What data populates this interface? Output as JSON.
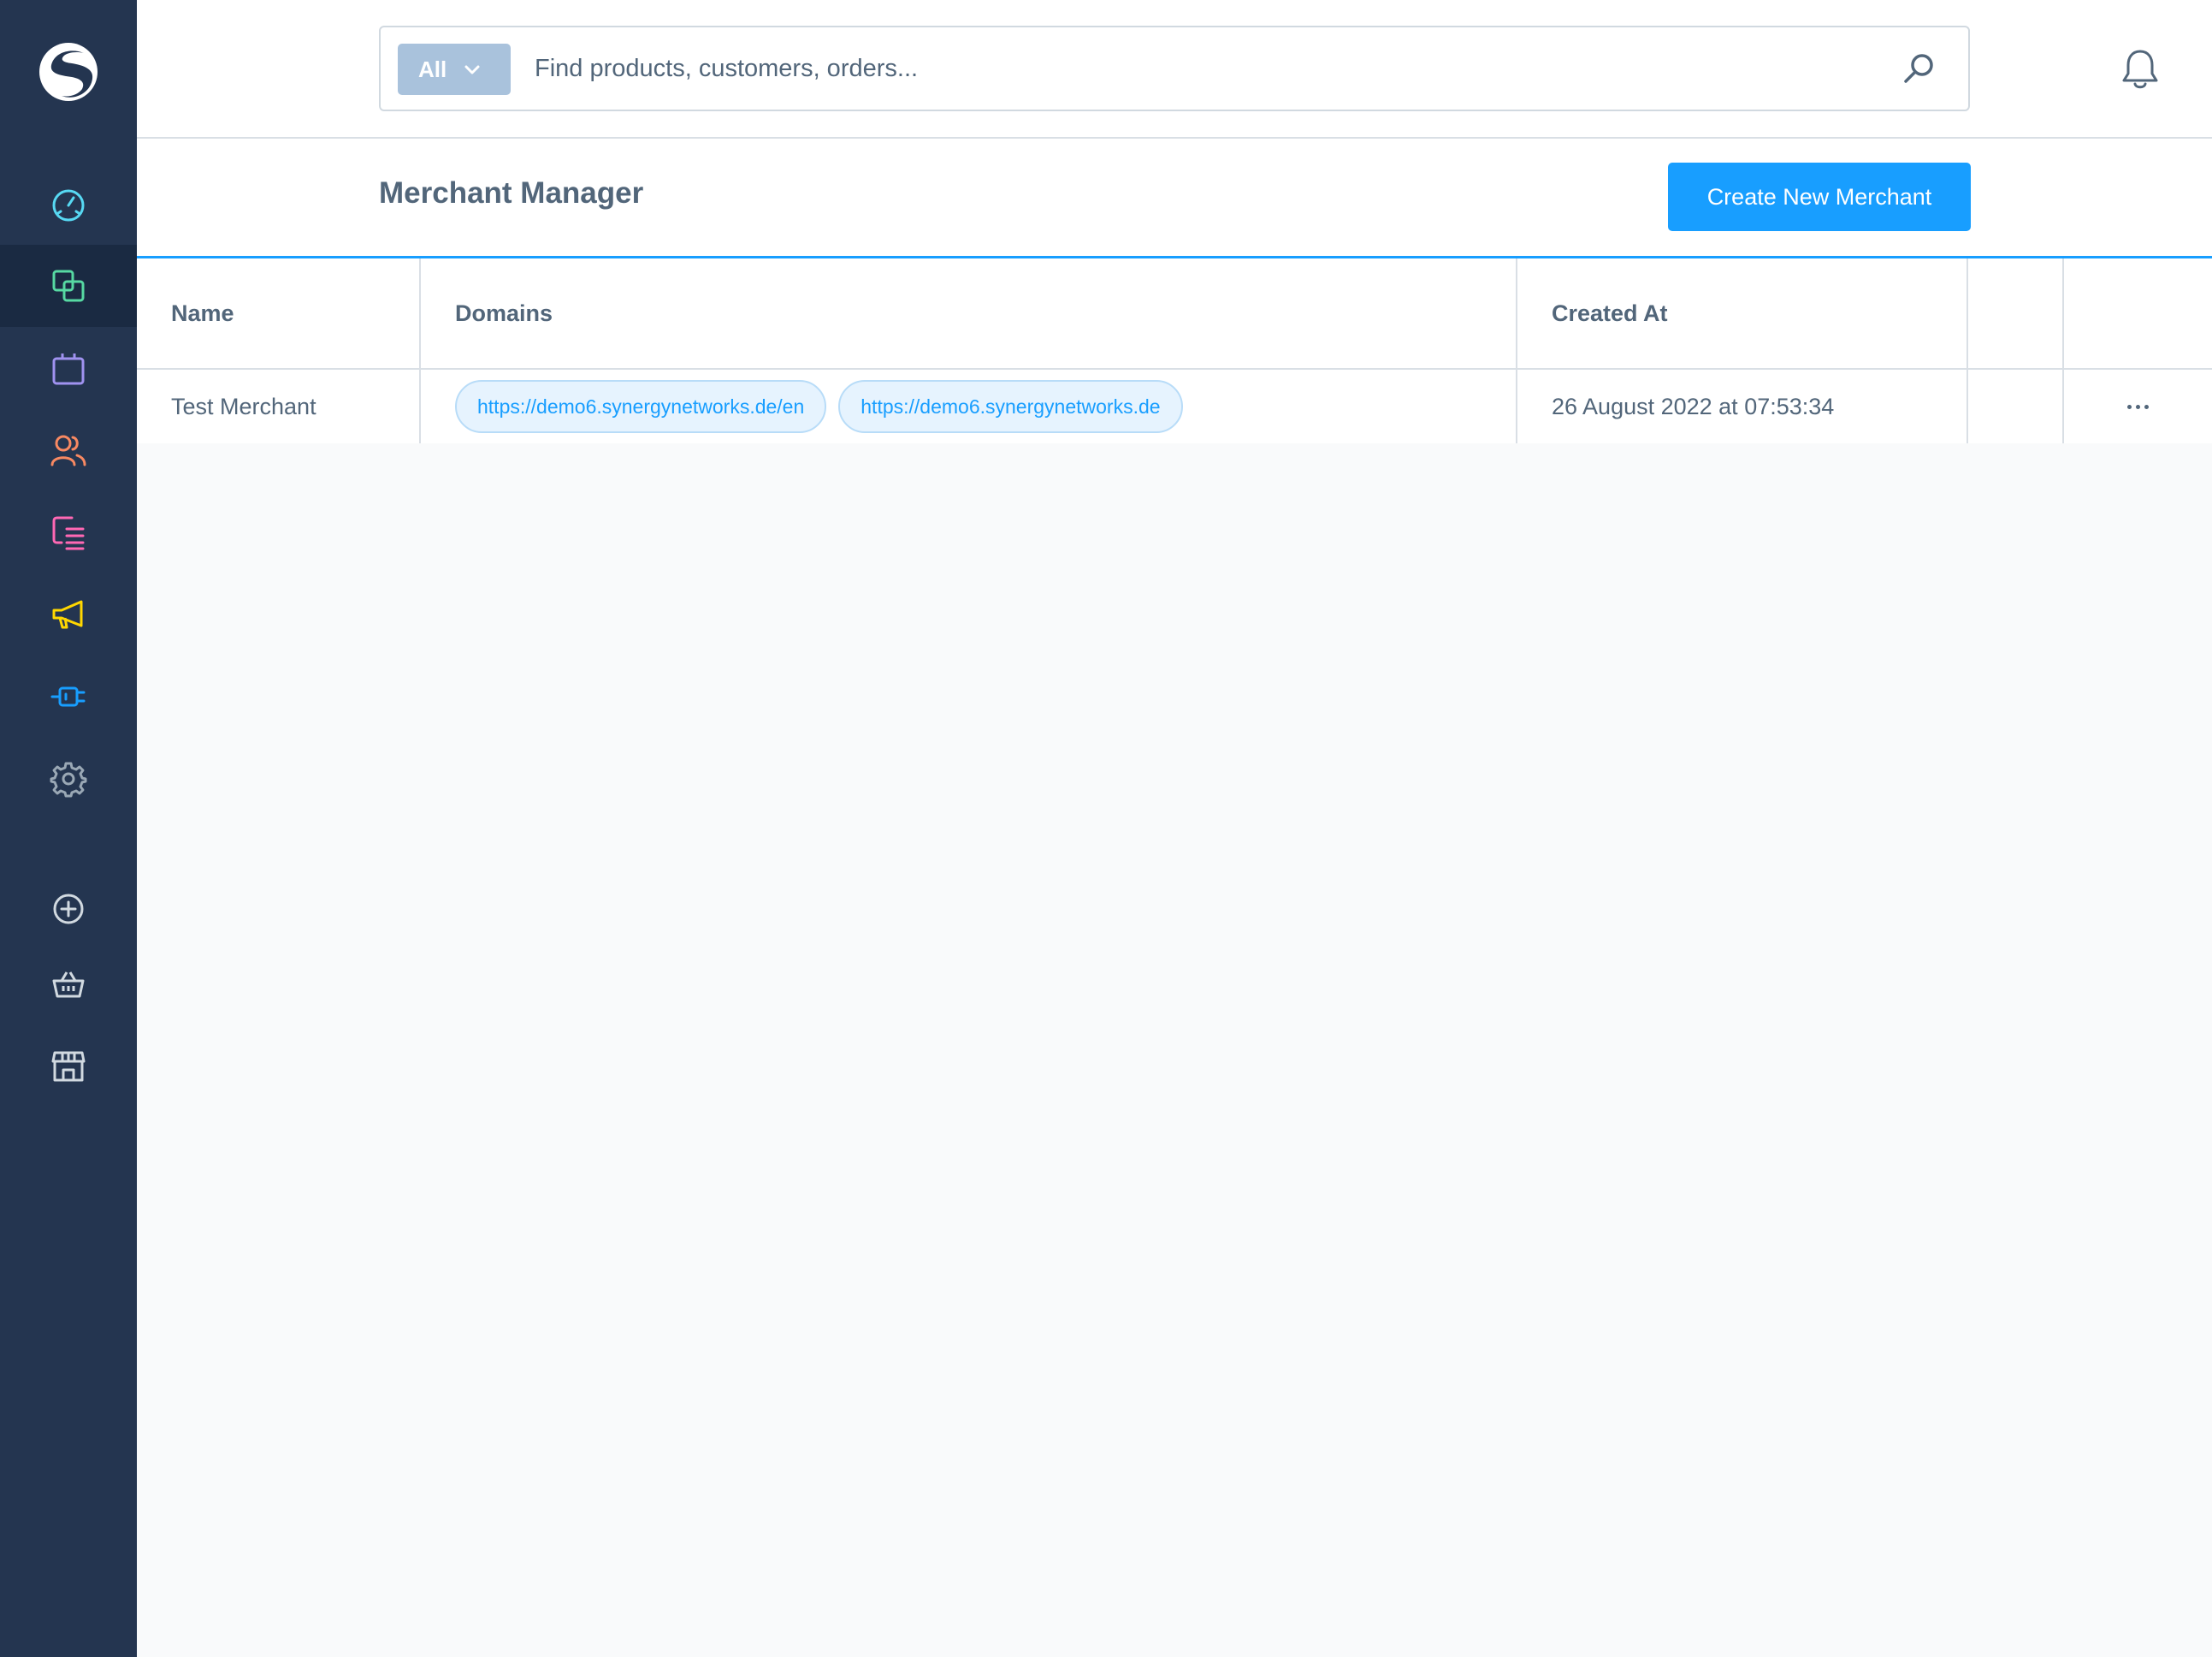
{
  "search": {
    "type_label": "All",
    "placeholder": "Find products, customers, orders..."
  },
  "page": {
    "title": "Merchant Manager",
    "create_button": "Create New Merchant"
  },
  "table": {
    "columns": [
      "Name",
      "Domains",
      "Created At",
      "",
      ""
    ],
    "rows": [
      {
        "name": "Test Merchant",
        "domains": [
          "https://demo6.synergynetworks.de/en",
          "https://demo6.synergynetworks.de"
        ],
        "created_at": "26 August 2022 at 07:53:34"
      }
    ]
  },
  "sidebar": {
    "items": [
      {
        "icon": "dashboard-icon",
        "color": "#57d9f3"
      },
      {
        "icon": "catalogue-icon",
        "color": "#57d9a3"
      },
      {
        "icon": "orders-icon",
        "color": "#a092f0"
      },
      {
        "icon": "customers-icon",
        "color": "#f88962"
      },
      {
        "icon": "content-icon",
        "color": "#ff68b4"
      },
      {
        "icon": "marketing-icon",
        "color": "#ffd700"
      },
      {
        "icon": "extensions-icon",
        "color": "#189eff"
      },
      {
        "icon": "settings-icon",
        "color": "#9aa8b5"
      },
      {
        "icon": "add-sales-channel-icon",
        "color": "#d1d9e0"
      },
      {
        "icon": "storefront-basket-icon",
        "color": "#d1d9e0"
      },
      {
        "icon": "shop-icon",
        "color": "#d1d9e0"
      }
    ]
  }
}
